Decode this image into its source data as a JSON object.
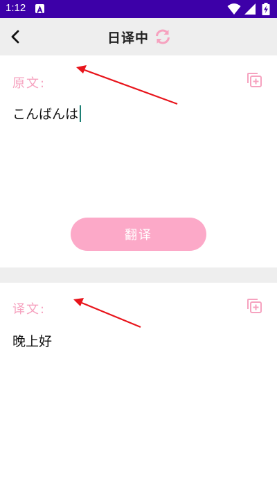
{
  "status_bar": {
    "time": "1:12"
  },
  "app_bar": {
    "title": "日译中",
    "back_icon": "chevron-left-icon",
    "swap_icon": "sync-icon"
  },
  "source": {
    "label": "原文:",
    "text": "こんばんは",
    "copy_icon": "copy-plus-icon"
  },
  "translate_button": {
    "label": "翻译"
  },
  "result": {
    "label": "译文:",
    "text": "晚上好",
    "copy_icon": "copy-plus-icon"
  },
  "colors": {
    "status_bar": "#3d00a8",
    "accent_pink": "#f6a2bf",
    "button_pink": "#fca9c8",
    "annotation_arrow": "#e8141b"
  }
}
